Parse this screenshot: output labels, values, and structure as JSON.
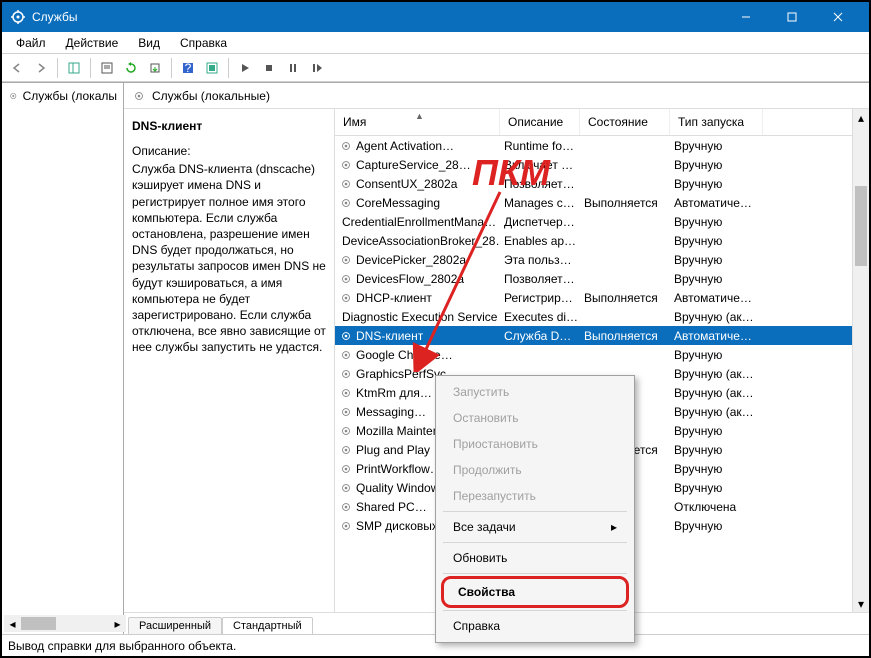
{
  "window": {
    "title": "Службы"
  },
  "menu": {
    "file": "Файл",
    "action": "Действие",
    "view": "Вид",
    "help": "Справка"
  },
  "tree": {
    "root": "Службы (локалы"
  },
  "header2": "Службы (локальные)",
  "descpane": {
    "svcname": "DNS-клиент",
    "dlabel": "Описание:",
    "dtext": "Служба DNS-клиента (dnscache) кэширует имена DNS и регистрирует полное имя этого компьютера. Если служба остановлена, разрешение имен DNS будет продолжаться, но результаты запросов имен DNS не будут кэшироваться, а имя компьютера не будет зарегистрировано. Если служба отключена, все явно зависящие от нее службы запустить не удастся."
  },
  "cols": {
    "name": "Имя",
    "desc": "Описание",
    "state": "Состояние",
    "start": "Тип запуска"
  },
  "rows": [
    {
      "n": "Agent Activation…",
      "d": "Runtime fo…",
      "s": "",
      "t": "Вручную"
    },
    {
      "n": "CaptureService_28…",
      "d": "Включает …",
      "s": "",
      "t": "Вручную"
    },
    {
      "n": "ConsentUX_2802a",
      "d": "Позволяет…",
      "s": "",
      "t": "Вручную"
    },
    {
      "n": "CoreMessaging",
      "d": "Manages c…",
      "s": "Выполняется",
      "t": "Автоматиче…"
    },
    {
      "n": "CredentialEnrollmentMana…",
      "d": "Диспетчер…",
      "s": "",
      "t": "Вручную"
    },
    {
      "n": "DeviceAssociationBroker_28…",
      "d": "Enables ap…",
      "s": "",
      "t": "Вручную"
    },
    {
      "n": "DevicePicker_2802a",
      "d": "Эта польз…",
      "s": "",
      "t": "Вручную"
    },
    {
      "n": "DevicesFlow_2802a",
      "d": "Позволяет…",
      "s": "",
      "t": "Вручную"
    },
    {
      "n": "DHCP-клиент",
      "d": "Регистрир…",
      "s": "Выполняется",
      "t": "Автоматиче…"
    },
    {
      "n": "Diagnostic Execution Service",
      "d": "Executes di…",
      "s": "",
      "t": "Вручную (ак…"
    },
    {
      "n": "DNS-клиент",
      "d": "Служба D…",
      "s": "Выполняется",
      "t": "Автоматиче…",
      "sel": true
    },
    {
      "n": "Google Chrome…",
      "d": "",
      "s": "",
      "t": "Вручную"
    },
    {
      "n": "GraphicsPerfSvc",
      "d": "",
      "s": "",
      "t": "Вручную (ак…"
    },
    {
      "n": "KtmRm для…",
      "d": "",
      "s": "",
      "t": "Вручную (ак…"
    },
    {
      "n": "Messaging…",
      "d": "",
      "s": "",
      "t": "Вручную (ак…"
    },
    {
      "n": "Mozilla Maintenance",
      "d": "",
      "s": "",
      "t": "Вручную"
    },
    {
      "n": "Plug and Play",
      "d": "",
      "s": "Выполняется",
      "t": "Вручную"
    },
    {
      "n": "PrintWorkflow…",
      "d": "",
      "s": "",
      "t": "Вручную"
    },
    {
      "n": "Quality Windows…",
      "d": "",
      "s": "",
      "t": "Вручную"
    },
    {
      "n": "Shared PC…",
      "d": "",
      "s": "",
      "t": "Отключена"
    },
    {
      "n": "SMP дисковых…",
      "d": "",
      "s": "",
      "t": "Вручную"
    }
  ],
  "tabs": {
    "ext": "Расширенный",
    "std": "Стандартный"
  },
  "status": "Вывод справки для выбранного объекта.",
  "ctx": {
    "start": "Запустить",
    "stop": "Остановить",
    "pause": "Приостановить",
    "resume": "Продолжить",
    "restart": "Перезапустить",
    "alltasks": "Все задачи",
    "refresh": "Обновить",
    "props": "Свойства",
    "help": "Справка"
  },
  "annotation": "ПКМ"
}
